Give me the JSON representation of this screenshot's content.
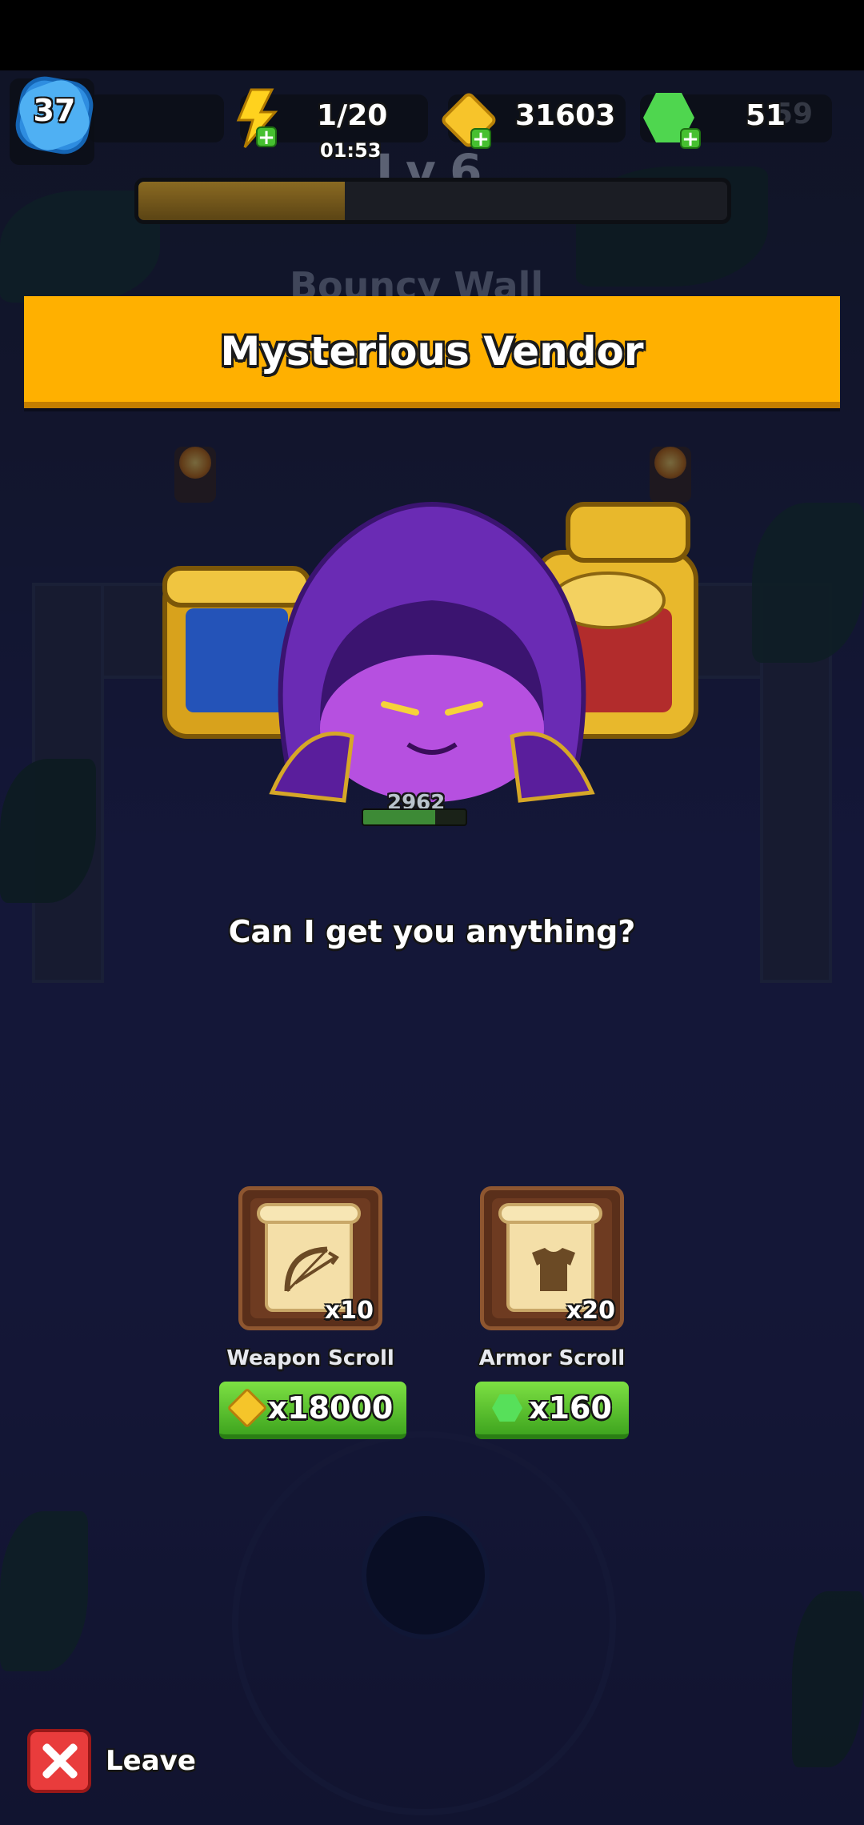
{
  "hud": {
    "player_level": "37",
    "energy": "1/20",
    "energy_timer": "01:53",
    "gold": "31603",
    "gems": "51",
    "gems_ghost": "59",
    "stage_label": "Lv.6",
    "stage_progress": 0.35
  },
  "background": {
    "room_title": "Bouncy Wall",
    "enemy_hp": "2962",
    "enemy_hp_fraction": 0.7
  },
  "vendor": {
    "title": "Mysterious Vendor",
    "prompt": "Can I get you anything?"
  },
  "offers": [
    {
      "name": "Weapon Scroll",
      "quantity": "x10",
      "icon": "bow-scroll-icon",
      "price": "x18000",
      "currency": "gold"
    },
    {
      "name": "Armor Scroll",
      "quantity": "x20",
      "icon": "armor-scroll-icon",
      "price": "x160",
      "currency": "gem"
    }
  ],
  "leave": {
    "label": "Leave"
  },
  "colors": {
    "banner": "#ffb000",
    "buy_button": "#5cc832",
    "leave_button": "#e93c3c",
    "level_badge": "#2e8de0"
  }
}
